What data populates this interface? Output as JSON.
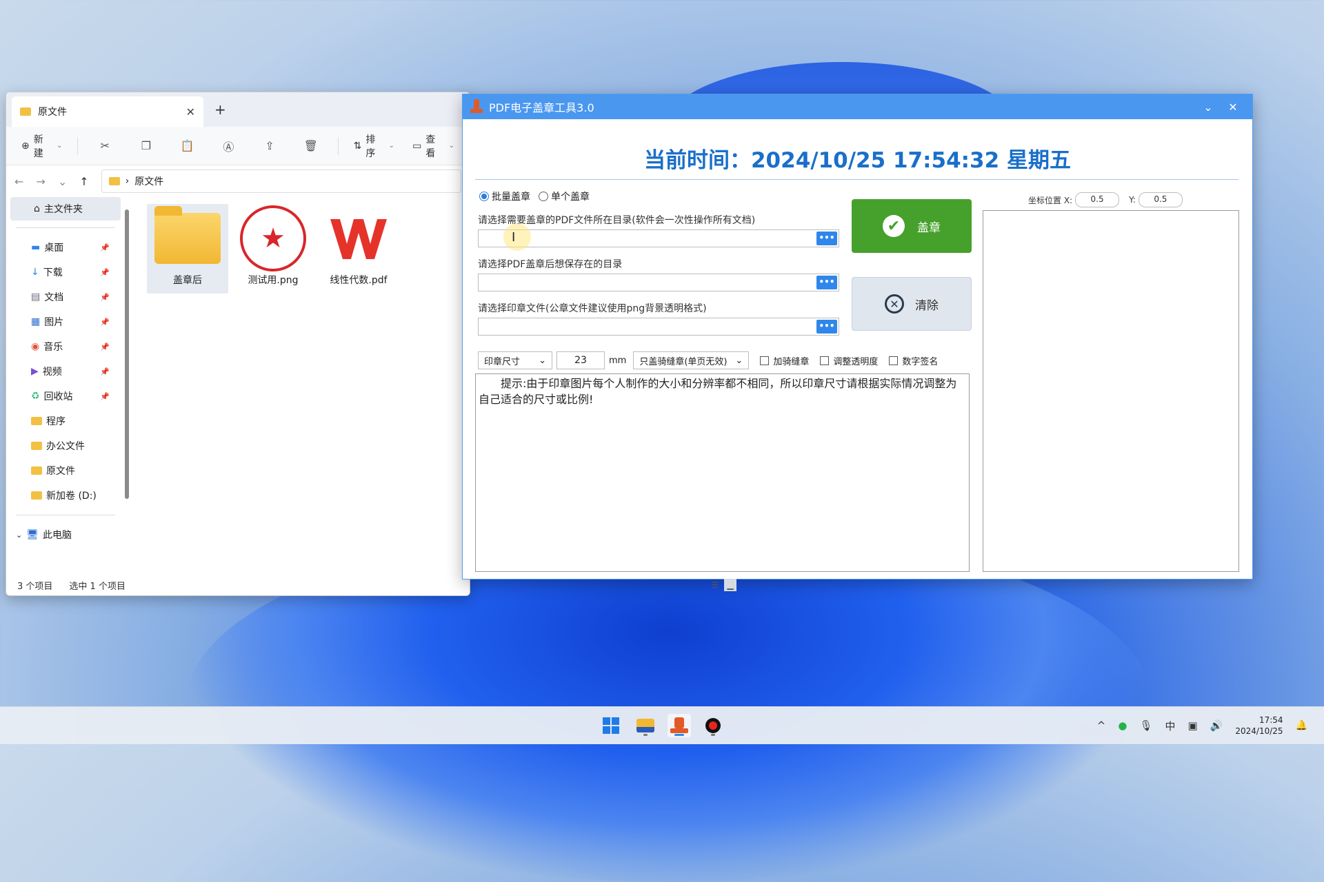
{
  "explorer": {
    "tab_label": "原文件",
    "toolbar": {
      "new_label": "新建",
      "sort_label": "排序",
      "view_label": "查看"
    },
    "breadcrumb": "原文件",
    "nav": {
      "home_label": "主文件夹",
      "items": [
        {
          "label": "桌面",
          "pinned": true
        },
        {
          "label": "下载",
          "pinned": true
        },
        {
          "label": "文档",
          "pinned": true
        },
        {
          "label": "图片",
          "pinned": true
        },
        {
          "label": "音乐",
          "pinned": true
        },
        {
          "label": "视频",
          "pinned": true
        },
        {
          "label": "回收站",
          "pinned": true
        },
        {
          "label": "程序",
          "pinned": false
        },
        {
          "label": "办公文件",
          "pinned": false
        },
        {
          "label": "原文件",
          "pinned": false
        },
        {
          "label": "新加卷 (D:)",
          "pinned": false
        }
      ],
      "this_pc_label": "此电脑"
    },
    "files": [
      {
        "name": "盖章后",
        "kind": "folder",
        "selected": true
      },
      {
        "name": "测试用.png",
        "kind": "image"
      },
      {
        "name": "线性代数.pdf",
        "kind": "pdf"
      }
    ],
    "status": {
      "count": "3 个项目",
      "selection": "选中 1 个项目"
    }
  },
  "tool": {
    "title": "PDF电子盖章工具3.0",
    "clock_text": "当前时间：2024/10/25 17:54:32  星期五",
    "mode": {
      "batch_label": "批量盖章",
      "single_label": "单个盖章",
      "selected": "batch"
    },
    "fields": {
      "pdf_dir_label": "请选择需要盖章的PDF文件所在目录(软件会一次性操作所有文档)",
      "save_dir_label": "请选择PDF盖章后想保存在的目录",
      "stamp_file_label": "请选择印章文件(公章文件建议使用png背景透明格式)",
      "browse_label": "•••"
    },
    "stamp_button_label": "盖章",
    "clear_button_label": "清除",
    "options": {
      "size_mode": "印章尺寸",
      "size_value": "23",
      "size_unit": "mm",
      "seam_mode": "只盖骑缝章(单页无效)",
      "checkboxes": [
        {
          "label": "加骑缝章",
          "checked": false
        },
        {
          "label": "调整透明度",
          "checked": false
        },
        {
          "label": "数字签名",
          "checked": false
        }
      ]
    },
    "hint": "提示:由于印章图片每个人制作的大小和分辨率都不相同，所以印章尺寸请根据实际情况调整为自己适合的尺寸或比例!",
    "coords": {
      "label": "坐标位置 X:",
      "x_value": "0.5",
      "y_label": "Y:",
      "y_value": "0.5"
    }
  },
  "taskbar": {
    "ime_label": "中",
    "time": "17:54",
    "date": "2024/10/25"
  },
  "colors": {
    "title_blue": "#4a97f0",
    "clock_blue": "#1a6fc9",
    "stamp_green": "#46a12c",
    "browse_blue": "#2f86eb"
  }
}
